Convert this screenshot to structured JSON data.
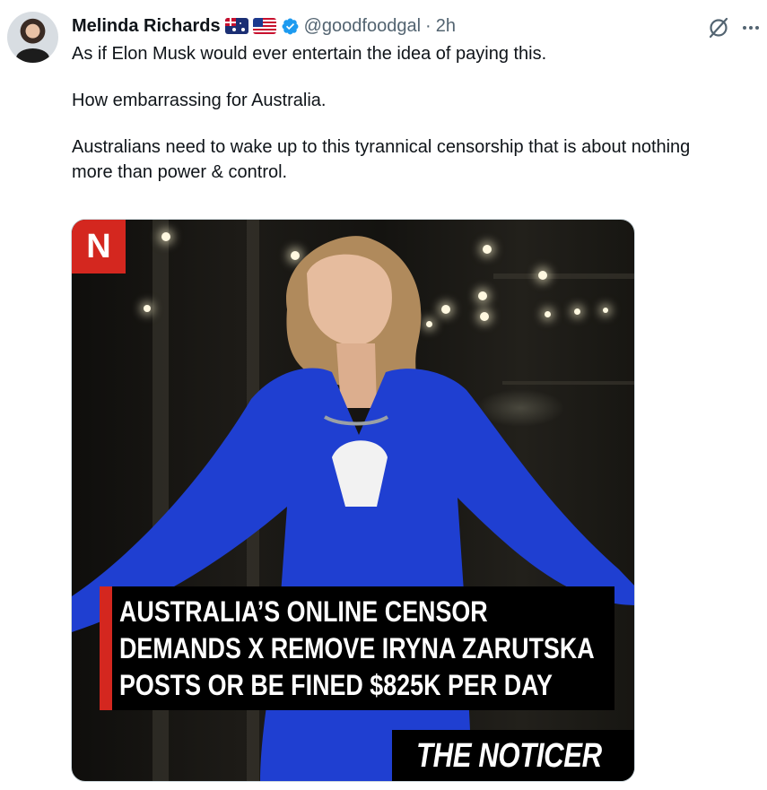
{
  "post": {
    "author_name": "Melinda Richards",
    "flags": [
      "australia-flag",
      "usa-flag"
    ],
    "verified": true,
    "handle": "@goodfoodgal",
    "separator": "·",
    "time": "2h",
    "body": [
      "As if Elon Musk would ever entertain the idea of paying this.",
      "How embarrassing for Australia.",
      "Australians need to wake up to this tyrannical censorship that is about nothing more than power & control."
    ],
    "actions": {
      "grok_icon": "grok-slash-circle-icon",
      "more_icon": "more-horizontal-icon"
    }
  },
  "media": {
    "logo_letter": "N",
    "headline_lines": [
      "AUSTRALIA’S ONLINE CENSOR",
      "DEMANDS X REMOVE IRYNA ZARUTSKA",
      "POSTS OR BE FINED $825K PER DAY"
    ],
    "brand": "THE NOTICER"
  },
  "colors": {
    "text": "#0f1419",
    "secondary": "#536471",
    "verified_blue": "#1d9bf0",
    "brand_red": "#d4271f",
    "suit_blue": "#1f3fd1"
  }
}
